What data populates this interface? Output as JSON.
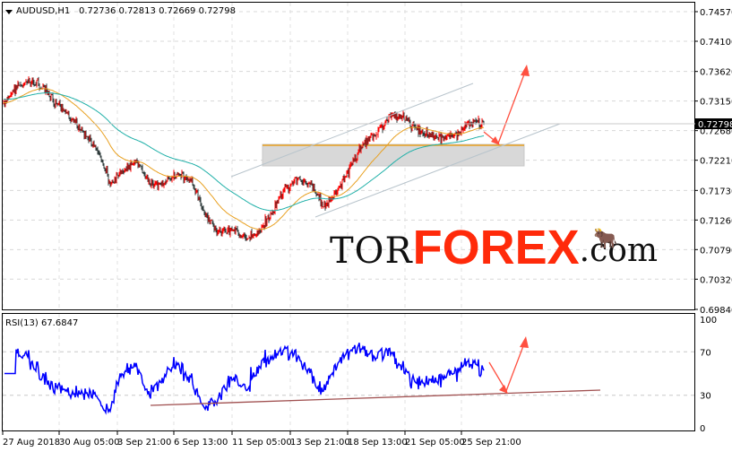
{
  "header": {
    "menu_icon": "triangle-down-icon",
    "symbol": "AUDUSD,H1",
    "ohlc": "0.72736 0.72813 0.72669 0.72798"
  },
  "rsi_label": "RSI(13) 67.6847",
  "logo": {
    "part1": "TOR",
    "part2": "FOREX",
    "part3": ".com"
  },
  "colors": {
    "bull": "#ff0000",
    "bear": "#2f3b3b",
    "ma_fast": "#e8a020",
    "ma_slow": "#20b0a8",
    "rsi": "#0000ff",
    "arrow": "#ff5040",
    "trendline": "#a05050",
    "channel": "#b8c4cc"
  },
  "chart_data": {
    "type": "candlestick",
    "symbol": "AUDUSD",
    "timeframe": "H1",
    "current_price": "0.72798",
    "price_ticks": [
      "0.74570",
      "0.74100",
      "0.73620",
      "0.73150",
      "0.72680",
      "0.72210",
      "0.71730",
      "0.71260",
      "0.70790",
      "0.70320",
      "0.69840"
    ],
    "ylim": [
      0.6984,
      0.7457
    ],
    "time_ticks": [
      "27 Aug 2018",
      "30 Aug 05:00",
      "3 Sep 21:00",
      "6 Sep 13:00",
      "11 Sep 05:00",
      "13 Sep 21:00",
      "18 Sep 13:00",
      "21 Sep 05:00",
      "25 Sep 21:00"
    ],
    "approx_close_path": [
      0.7312,
      0.734,
      0.7347,
      0.7333,
      0.7312,
      0.729,
      0.7262,
      0.724,
      0.7183,
      0.7205,
      0.7219,
      0.7183,
      0.7183,
      0.7198,
      0.719,
      0.7141,
      0.7105,
      0.7112,
      0.7098,
      0.7102,
      0.7133,
      0.7176,
      0.719,
      0.7183,
      0.7148,
      0.7169,
      0.7212,
      0.7247,
      0.7262,
      0.729,
      0.729,
      0.7269,
      0.7262,
      0.7255,
      0.7262,
      0.7283,
      0.728
    ],
    "rsi": {
      "period": 13,
      "value": "67.6847",
      "levels": [
        "100",
        "70",
        "30",
        "0"
      ]
    }
  }
}
